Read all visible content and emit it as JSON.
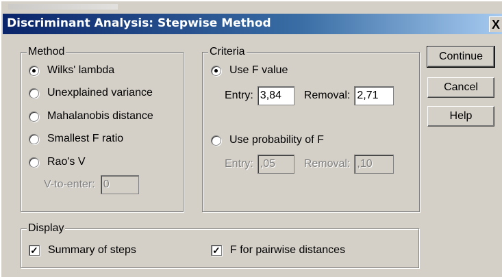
{
  "window": {
    "title": "Discriminant Analysis: Stepwise Method",
    "close_glyph": "X"
  },
  "method": {
    "legend": "Method",
    "options": [
      {
        "label": "Wilks' lambda",
        "selected": true
      },
      {
        "label": "Unexplained variance",
        "selected": false
      },
      {
        "label": "Mahalanobis distance",
        "selected": false
      },
      {
        "label": "Smallest F ratio",
        "selected": false
      },
      {
        "label": "Rao's V",
        "selected": false
      }
    ],
    "v_to_enter_label": "V-to-enter:",
    "v_to_enter_value": "0"
  },
  "criteria": {
    "legend": "Criteria",
    "use_f_value": {
      "label": "Use F value",
      "selected": true
    },
    "f_entry_label": "Entry:",
    "f_entry_value": "3,84",
    "f_removal_label": "Removal:",
    "f_removal_value": "2,71",
    "use_probability": {
      "label": "Use probability of F",
      "selected": false
    },
    "p_entry_label": "Entry:",
    "p_entry_value": ",05",
    "p_removal_label": "Removal:",
    "p_removal_value": ",10"
  },
  "buttons": {
    "continue": "Continue",
    "cancel": "Cancel",
    "help": "Help"
  },
  "display": {
    "legend": "Display",
    "summary_of_steps": {
      "label": "Summary of steps",
      "checked": true
    },
    "f_pairwise": {
      "label": "F for pairwise distances",
      "checked": true
    },
    "check_glyph": "✓"
  }
}
